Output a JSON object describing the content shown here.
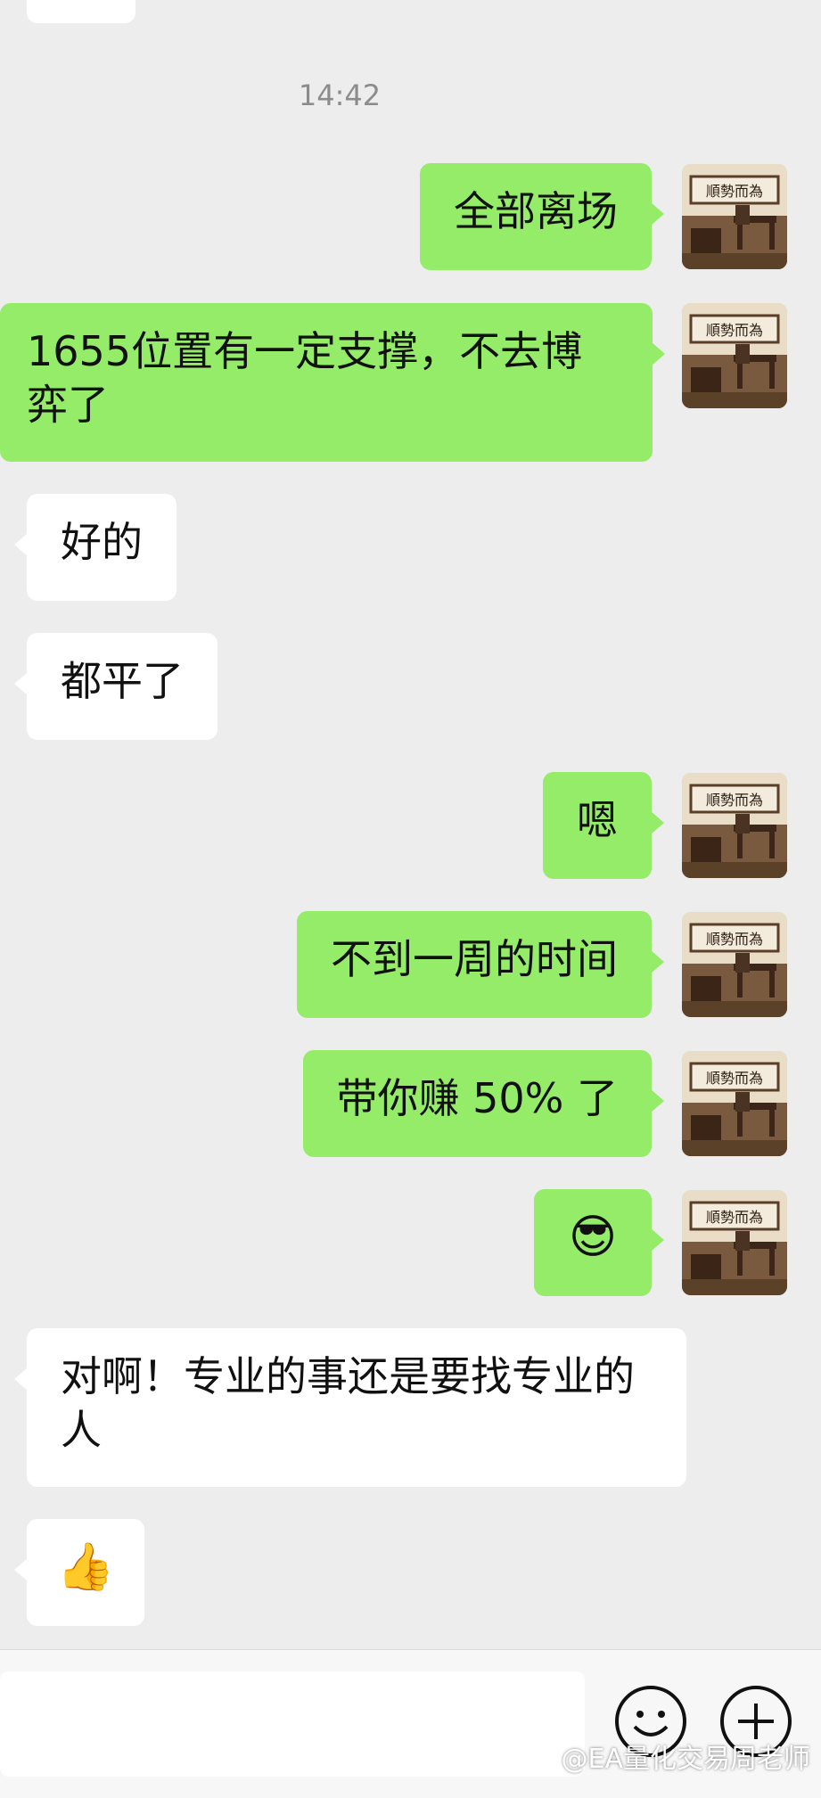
{
  "chat": {
    "timestamp": "14:42",
    "messages": [
      {
        "side": "out",
        "text": "全部离场"
      },
      {
        "side": "out",
        "text": "1655位置有一定支撑，不去博弈了"
      },
      {
        "side": "in",
        "text": "好的"
      },
      {
        "side": "in",
        "text": "都平了"
      },
      {
        "side": "out",
        "text": "嗯"
      },
      {
        "side": "out",
        "text": "不到一周的时间"
      },
      {
        "side": "out",
        "text": "带你赚 50% 了"
      },
      {
        "side": "out",
        "text": "😎",
        "emoji": "cool-face-emoji"
      },
      {
        "side": "in",
        "text": "对啊！专业的事还是要找专业的人"
      },
      {
        "side": "in",
        "text": "👍",
        "emoji": "thumbs-up-emoji"
      }
    ],
    "avatar_calligraphy": "順勢而為"
  },
  "input": {
    "emoji_icon": "smiley-face-icon",
    "plus_icon": "plus-circle-icon"
  },
  "watermark": "@EA量化交易周老师",
  "colors": {
    "background": "#ededed",
    "outgoing_bubble": "#95ec69",
    "incoming_bubble": "#ffffff"
  }
}
